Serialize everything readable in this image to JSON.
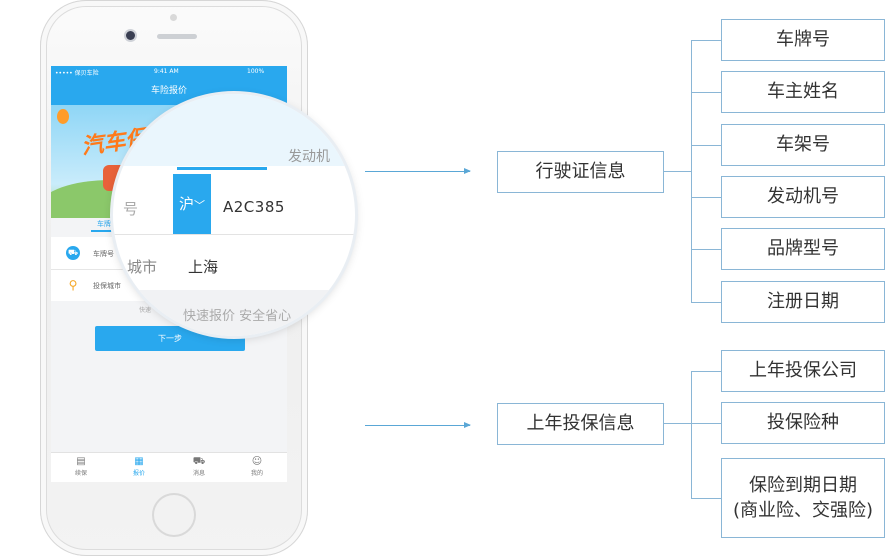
{
  "phone": {
    "status": {
      "carrier": "••••• 保贝车险",
      "wifi": "wifi-icon",
      "time": "9:41 AM",
      "battery": "100%"
    },
    "nav_title": "车险报价",
    "banner_title": "汽车保险",
    "tab_label": "车牌号",
    "form": {
      "plate_label": "车牌号",
      "city_label": "投保城市"
    },
    "hint": "快速",
    "next_button": "下一步",
    "tabbar": [
      {
        "label": "续保",
        "icon": "clipboard-icon"
      },
      {
        "label": "报价",
        "icon": "quote-icon",
        "active": true
      },
      {
        "label": "消息",
        "icon": "car-icon"
      },
      {
        "label": "我的",
        "icon": "user-icon"
      }
    ]
  },
  "magnifier": {
    "engine_label": "发动机",
    "plate_label": "号",
    "province": "沪",
    "plate_value": "A2C385",
    "city_label": "城市",
    "city_value": "上海",
    "slogan": "快速报价  安全省心"
  },
  "diagram": {
    "group1": {
      "title": "行驶证信息",
      "items": [
        "车牌号",
        "车主姓名",
        "车架号",
        "发动机号",
        "品牌型号",
        "注册日期"
      ]
    },
    "group2": {
      "title": "上年投保信息",
      "items": [
        "上年投保公司",
        "投保险种",
        "保险到期日期",
        "(商业险、交强险)"
      ]
    }
  }
}
